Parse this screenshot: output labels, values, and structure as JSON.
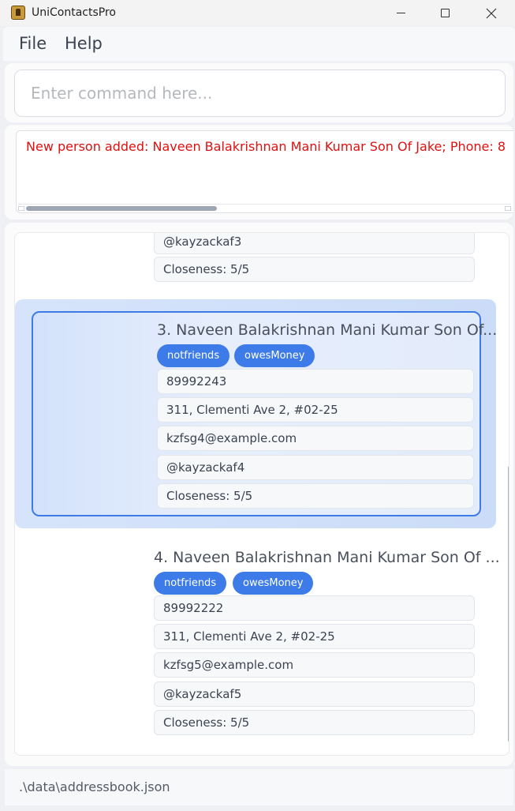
{
  "window": {
    "title": "UniContactsPro"
  },
  "menu": {
    "file": "File",
    "help": "Help"
  },
  "command": {
    "placeholder": "Enter command here...",
    "value": ""
  },
  "result": {
    "message": "New person added: Naveen Balakrishnan Mani Kumar Son Of Jake; Phone: 8"
  },
  "persons": [
    {
      "handle": "@kayzackaf3",
      "closeness": "Closeness: 5/5"
    },
    {
      "name": "3. Naveen Balakrishnan Mani Kumar Son Of...",
      "tags": [
        "notfriends",
        "owesMoney"
      ],
      "phone": "89992243",
      "address": "311, Clementi Ave 2, #02-25",
      "email": "kzfsg4@example.com",
      "handle": "@kayzackaf4",
      "closeness": "Closeness: 5/5",
      "selected": true
    },
    {
      "name": "4. Naveen Balakrishnan Mani Kumar Son Of ...",
      "tags": [
        "notfriends",
        "owesMoney"
      ],
      "phone": "89992222",
      "address": "311, Clementi Ave 2, #02-25",
      "email": "kzfsg5@example.com",
      "handle": "@kayzackaf5",
      "closeness": "Closeness: 5/5"
    }
  ],
  "status": {
    "path": ".\\data\\addressbook.json"
  },
  "colors": {
    "accent": "#3d7be8",
    "error_text": "#e01010",
    "selection": "#cbdcf8"
  }
}
